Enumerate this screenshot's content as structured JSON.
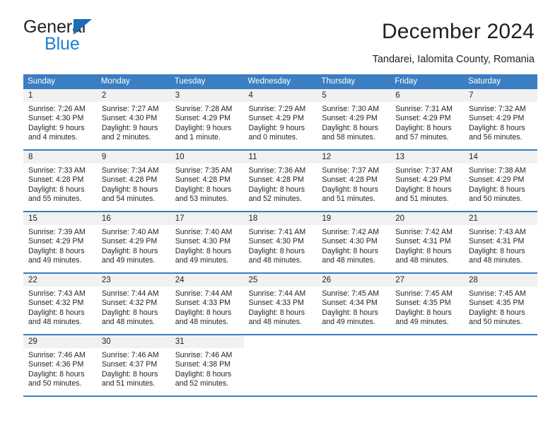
{
  "brand": {
    "line1": "General",
    "line2": "Blue",
    "triangle_color": "#1a6cb5",
    "blue_text_color": "#1b7fd4"
  },
  "header": {
    "title": "December 2024",
    "subtitle": "Tandarei, Ialomita County, Romania"
  },
  "calendar": {
    "accent_color": "#3b7ec1",
    "daynum_bg": "#f1f1f1",
    "weekday_headers": [
      "Sunday",
      "Monday",
      "Tuesday",
      "Wednesday",
      "Thursday",
      "Friday",
      "Saturday"
    ],
    "weeks": [
      [
        {
          "day": "1",
          "sunrise": "Sunrise: 7:26 AM",
          "sunset": "Sunset: 4:30 PM",
          "daylight1": "Daylight: 9 hours",
          "daylight2": "and 4 minutes."
        },
        {
          "day": "2",
          "sunrise": "Sunrise: 7:27 AM",
          "sunset": "Sunset: 4:30 PM",
          "daylight1": "Daylight: 9 hours",
          "daylight2": "and 2 minutes."
        },
        {
          "day": "3",
          "sunrise": "Sunrise: 7:28 AM",
          "sunset": "Sunset: 4:29 PM",
          "daylight1": "Daylight: 9 hours",
          "daylight2": "and 1 minute."
        },
        {
          "day": "4",
          "sunrise": "Sunrise: 7:29 AM",
          "sunset": "Sunset: 4:29 PM",
          "daylight1": "Daylight: 9 hours",
          "daylight2": "and 0 minutes."
        },
        {
          "day": "5",
          "sunrise": "Sunrise: 7:30 AM",
          "sunset": "Sunset: 4:29 PM",
          "daylight1": "Daylight: 8 hours",
          "daylight2": "and 58 minutes."
        },
        {
          "day": "6",
          "sunrise": "Sunrise: 7:31 AM",
          "sunset": "Sunset: 4:29 PM",
          "daylight1": "Daylight: 8 hours",
          "daylight2": "and 57 minutes."
        },
        {
          "day": "7",
          "sunrise": "Sunrise: 7:32 AM",
          "sunset": "Sunset: 4:29 PM",
          "daylight1": "Daylight: 8 hours",
          "daylight2": "and 56 minutes."
        }
      ],
      [
        {
          "day": "8",
          "sunrise": "Sunrise: 7:33 AM",
          "sunset": "Sunset: 4:28 PM",
          "daylight1": "Daylight: 8 hours",
          "daylight2": "and 55 minutes."
        },
        {
          "day": "9",
          "sunrise": "Sunrise: 7:34 AM",
          "sunset": "Sunset: 4:28 PM",
          "daylight1": "Daylight: 8 hours",
          "daylight2": "and 54 minutes."
        },
        {
          "day": "10",
          "sunrise": "Sunrise: 7:35 AM",
          "sunset": "Sunset: 4:28 PM",
          "daylight1": "Daylight: 8 hours",
          "daylight2": "and 53 minutes."
        },
        {
          "day": "11",
          "sunrise": "Sunrise: 7:36 AM",
          "sunset": "Sunset: 4:28 PM",
          "daylight1": "Daylight: 8 hours",
          "daylight2": "and 52 minutes."
        },
        {
          "day": "12",
          "sunrise": "Sunrise: 7:37 AM",
          "sunset": "Sunset: 4:28 PM",
          "daylight1": "Daylight: 8 hours",
          "daylight2": "and 51 minutes."
        },
        {
          "day": "13",
          "sunrise": "Sunrise: 7:37 AM",
          "sunset": "Sunset: 4:29 PM",
          "daylight1": "Daylight: 8 hours",
          "daylight2": "and 51 minutes."
        },
        {
          "day": "14",
          "sunrise": "Sunrise: 7:38 AM",
          "sunset": "Sunset: 4:29 PM",
          "daylight1": "Daylight: 8 hours",
          "daylight2": "and 50 minutes."
        }
      ],
      [
        {
          "day": "15",
          "sunrise": "Sunrise: 7:39 AM",
          "sunset": "Sunset: 4:29 PM",
          "daylight1": "Daylight: 8 hours",
          "daylight2": "and 49 minutes."
        },
        {
          "day": "16",
          "sunrise": "Sunrise: 7:40 AM",
          "sunset": "Sunset: 4:29 PM",
          "daylight1": "Daylight: 8 hours",
          "daylight2": "and 49 minutes."
        },
        {
          "day": "17",
          "sunrise": "Sunrise: 7:40 AM",
          "sunset": "Sunset: 4:30 PM",
          "daylight1": "Daylight: 8 hours",
          "daylight2": "and 49 minutes."
        },
        {
          "day": "18",
          "sunrise": "Sunrise: 7:41 AM",
          "sunset": "Sunset: 4:30 PM",
          "daylight1": "Daylight: 8 hours",
          "daylight2": "and 48 minutes."
        },
        {
          "day": "19",
          "sunrise": "Sunrise: 7:42 AM",
          "sunset": "Sunset: 4:30 PM",
          "daylight1": "Daylight: 8 hours",
          "daylight2": "and 48 minutes."
        },
        {
          "day": "20",
          "sunrise": "Sunrise: 7:42 AM",
          "sunset": "Sunset: 4:31 PM",
          "daylight1": "Daylight: 8 hours",
          "daylight2": "and 48 minutes."
        },
        {
          "day": "21",
          "sunrise": "Sunrise: 7:43 AM",
          "sunset": "Sunset: 4:31 PM",
          "daylight1": "Daylight: 8 hours",
          "daylight2": "and 48 minutes."
        }
      ],
      [
        {
          "day": "22",
          "sunrise": "Sunrise: 7:43 AM",
          "sunset": "Sunset: 4:32 PM",
          "daylight1": "Daylight: 8 hours",
          "daylight2": "and 48 minutes."
        },
        {
          "day": "23",
          "sunrise": "Sunrise: 7:44 AM",
          "sunset": "Sunset: 4:32 PM",
          "daylight1": "Daylight: 8 hours",
          "daylight2": "and 48 minutes."
        },
        {
          "day": "24",
          "sunrise": "Sunrise: 7:44 AM",
          "sunset": "Sunset: 4:33 PM",
          "daylight1": "Daylight: 8 hours",
          "daylight2": "and 48 minutes."
        },
        {
          "day": "25",
          "sunrise": "Sunrise: 7:44 AM",
          "sunset": "Sunset: 4:33 PM",
          "daylight1": "Daylight: 8 hours",
          "daylight2": "and 48 minutes."
        },
        {
          "day": "26",
          "sunrise": "Sunrise: 7:45 AM",
          "sunset": "Sunset: 4:34 PM",
          "daylight1": "Daylight: 8 hours",
          "daylight2": "and 49 minutes."
        },
        {
          "day": "27",
          "sunrise": "Sunrise: 7:45 AM",
          "sunset": "Sunset: 4:35 PM",
          "daylight1": "Daylight: 8 hours",
          "daylight2": "and 49 minutes."
        },
        {
          "day": "28",
          "sunrise": "Sunrise: 7:45 AM",
          "sunset": "Sunset: 4:35 PM",
          "daylight1": "Daylight: 8 hours",
          "daylight2": "and 50 minutes."
        }
      ],
      [
        {
          "day": "29",
          "sunrise": "Sunrise: 7:46 AM",
          "sunset": "Sunset: 4:36 PM",
          "daylight1": "Daylight: 8 hours",
          "daylight2": "and 50 minutes."
        },
        {
          "day": "30",
          "sunrise": "Sunrise: 7:46 AM",
          "sunset": "Sunset: 4:37 PM",
          "daylight1": "Daylight: 8 hours",
          "daylight2": "and 51 minutes."
        },
        {
          "day": "31",
          "sunrise": "Sunrise: 7:46 AM",
          "sunset": "Sunset: 4:38 PM",
          "daylight1": "Daylight: 8 hours",
          "daylight2": "and 52 minutes."
        },
        {
          "day": "",
          "sunrise": "",
          "sunset": "",
          "daylight1": "",
          "daylight2": ""
        },
        {
          "day": "",
          "sunrise": "",
          "sunset": "",
          "daylight1": "",
          "daylight2": ""
        },
        {
          "day": "",
          "sunrise": "",
          "sunset": "",
          "daylight1": "",
          "daylight2": ""
        },
        {
          "day": "",
          "sunrise": "",
          "sunset": "",
          "daylight1": "",
          "daylight2": ""
        }
      ]
    ]
  }
}
